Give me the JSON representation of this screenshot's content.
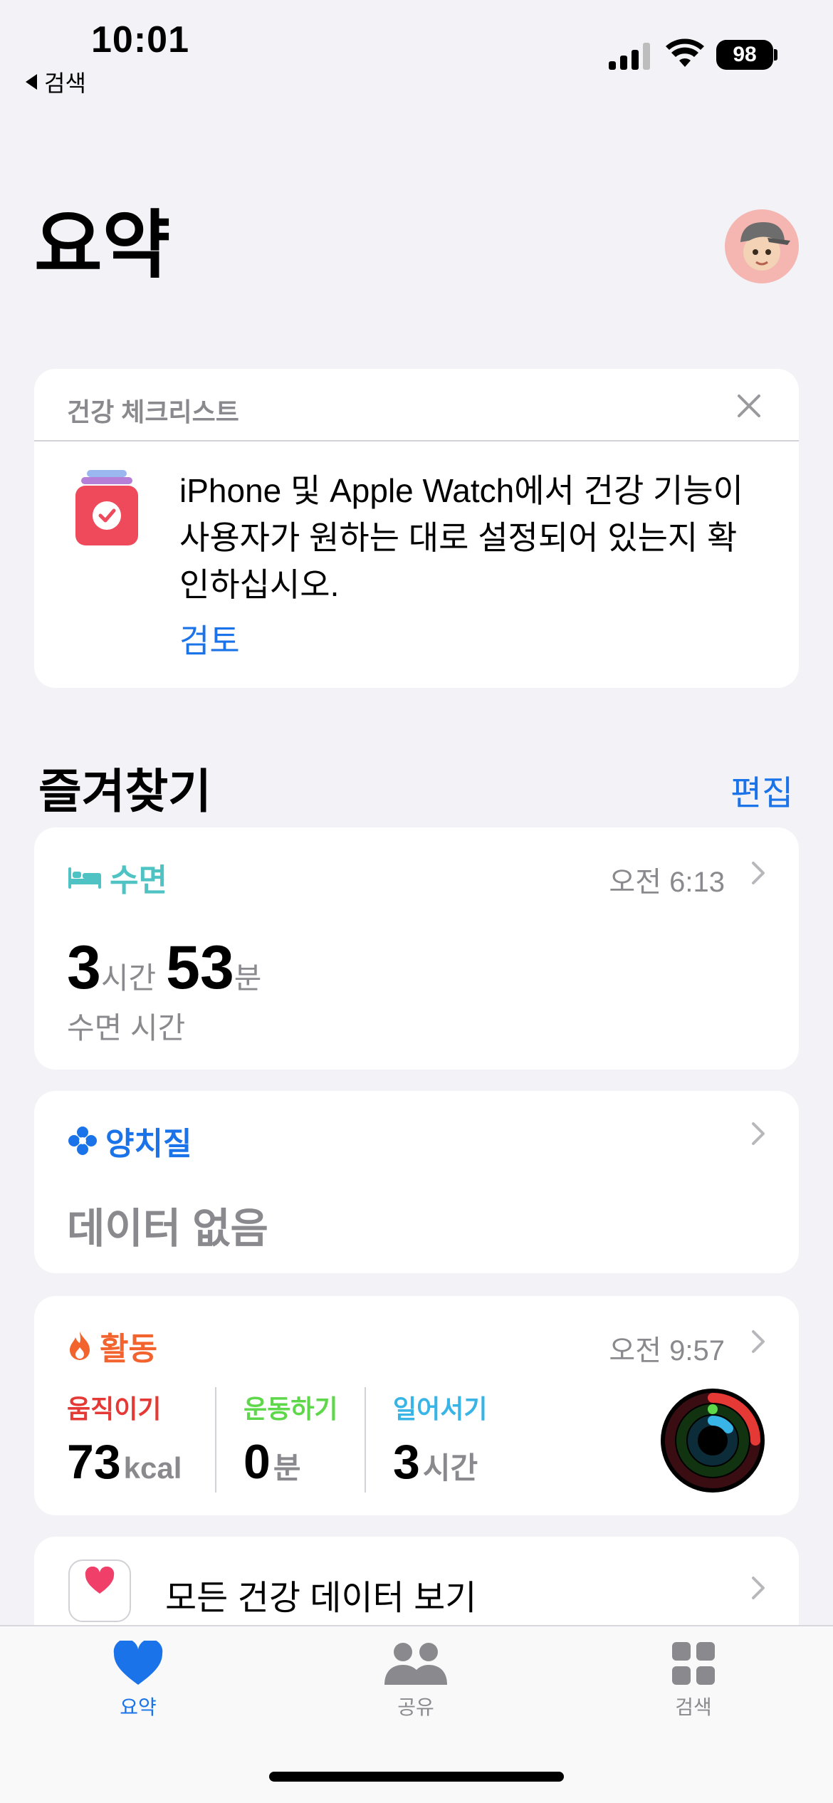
{
  "status_bar": {
    "time": "10:01",
    "back_label": "검색",
    "battery": "98"
  },
  "header": {
    "title": "요약"
  },
  "checklist": {
    "label": "건강 체크리스트",
    "text": "iPhone 및 Apple Watch에서 건강 기능이 사용자가 원하는 대로 설정되어 있는지 확인하십시오.",
    "action": "검토"
  },
  "favorites": {
    "title": "즐겨찾기",
    "edit_label": "편집",
    "sleep": {
      "title": "수면",
      "time": "오전 6:13",
      "hours": "3",
      "hours_unit": "시간",
      "minutes": "53",
      "minutes_unit": "분",
      "caption": "수면 시간",
      "color": "#4fc3c3"
    },
    "toothbrushing": {
      "title": "양치질",
      "no_data": "데이터 없음",
      "color": "#1a73e8"
    },
    "activity": {
      "title": "활동",
      "time": "오전 9:57",
      "color": "#f2632e",
      "move": {
        "label": "움직이기",
        "value": "73",
        "unit": "kcal",
        "color": "#e53935"
      },
      "exercise": {
        "label": "운동하기",
        "value": "0",
        "unit": "분",
        "color": "#5ed84a"
      },
      "stand": {
        "label": "일어서기",
        "value": "3",
        "unit": "시간",
        "color": "#38b4e6"
      }
    },
    "all_data": {
      "label": "모든 건강 데이터 보기"
    }
  },
  "tabbar": {
    "tabs": [
      {
        "label": "요약",
        "icon": "heart-icon",
        "active": true
      },
      {
        "label": "공유",
        "icon": "people-icon",
        "active": false
      },
      {
        "label": "검색",
        "icon": "grid-icon",
        "active": false
      }
    ],
    "active_color": "#1a73e8",
    "inactive_color": "#8a8a8e"
  }
}
